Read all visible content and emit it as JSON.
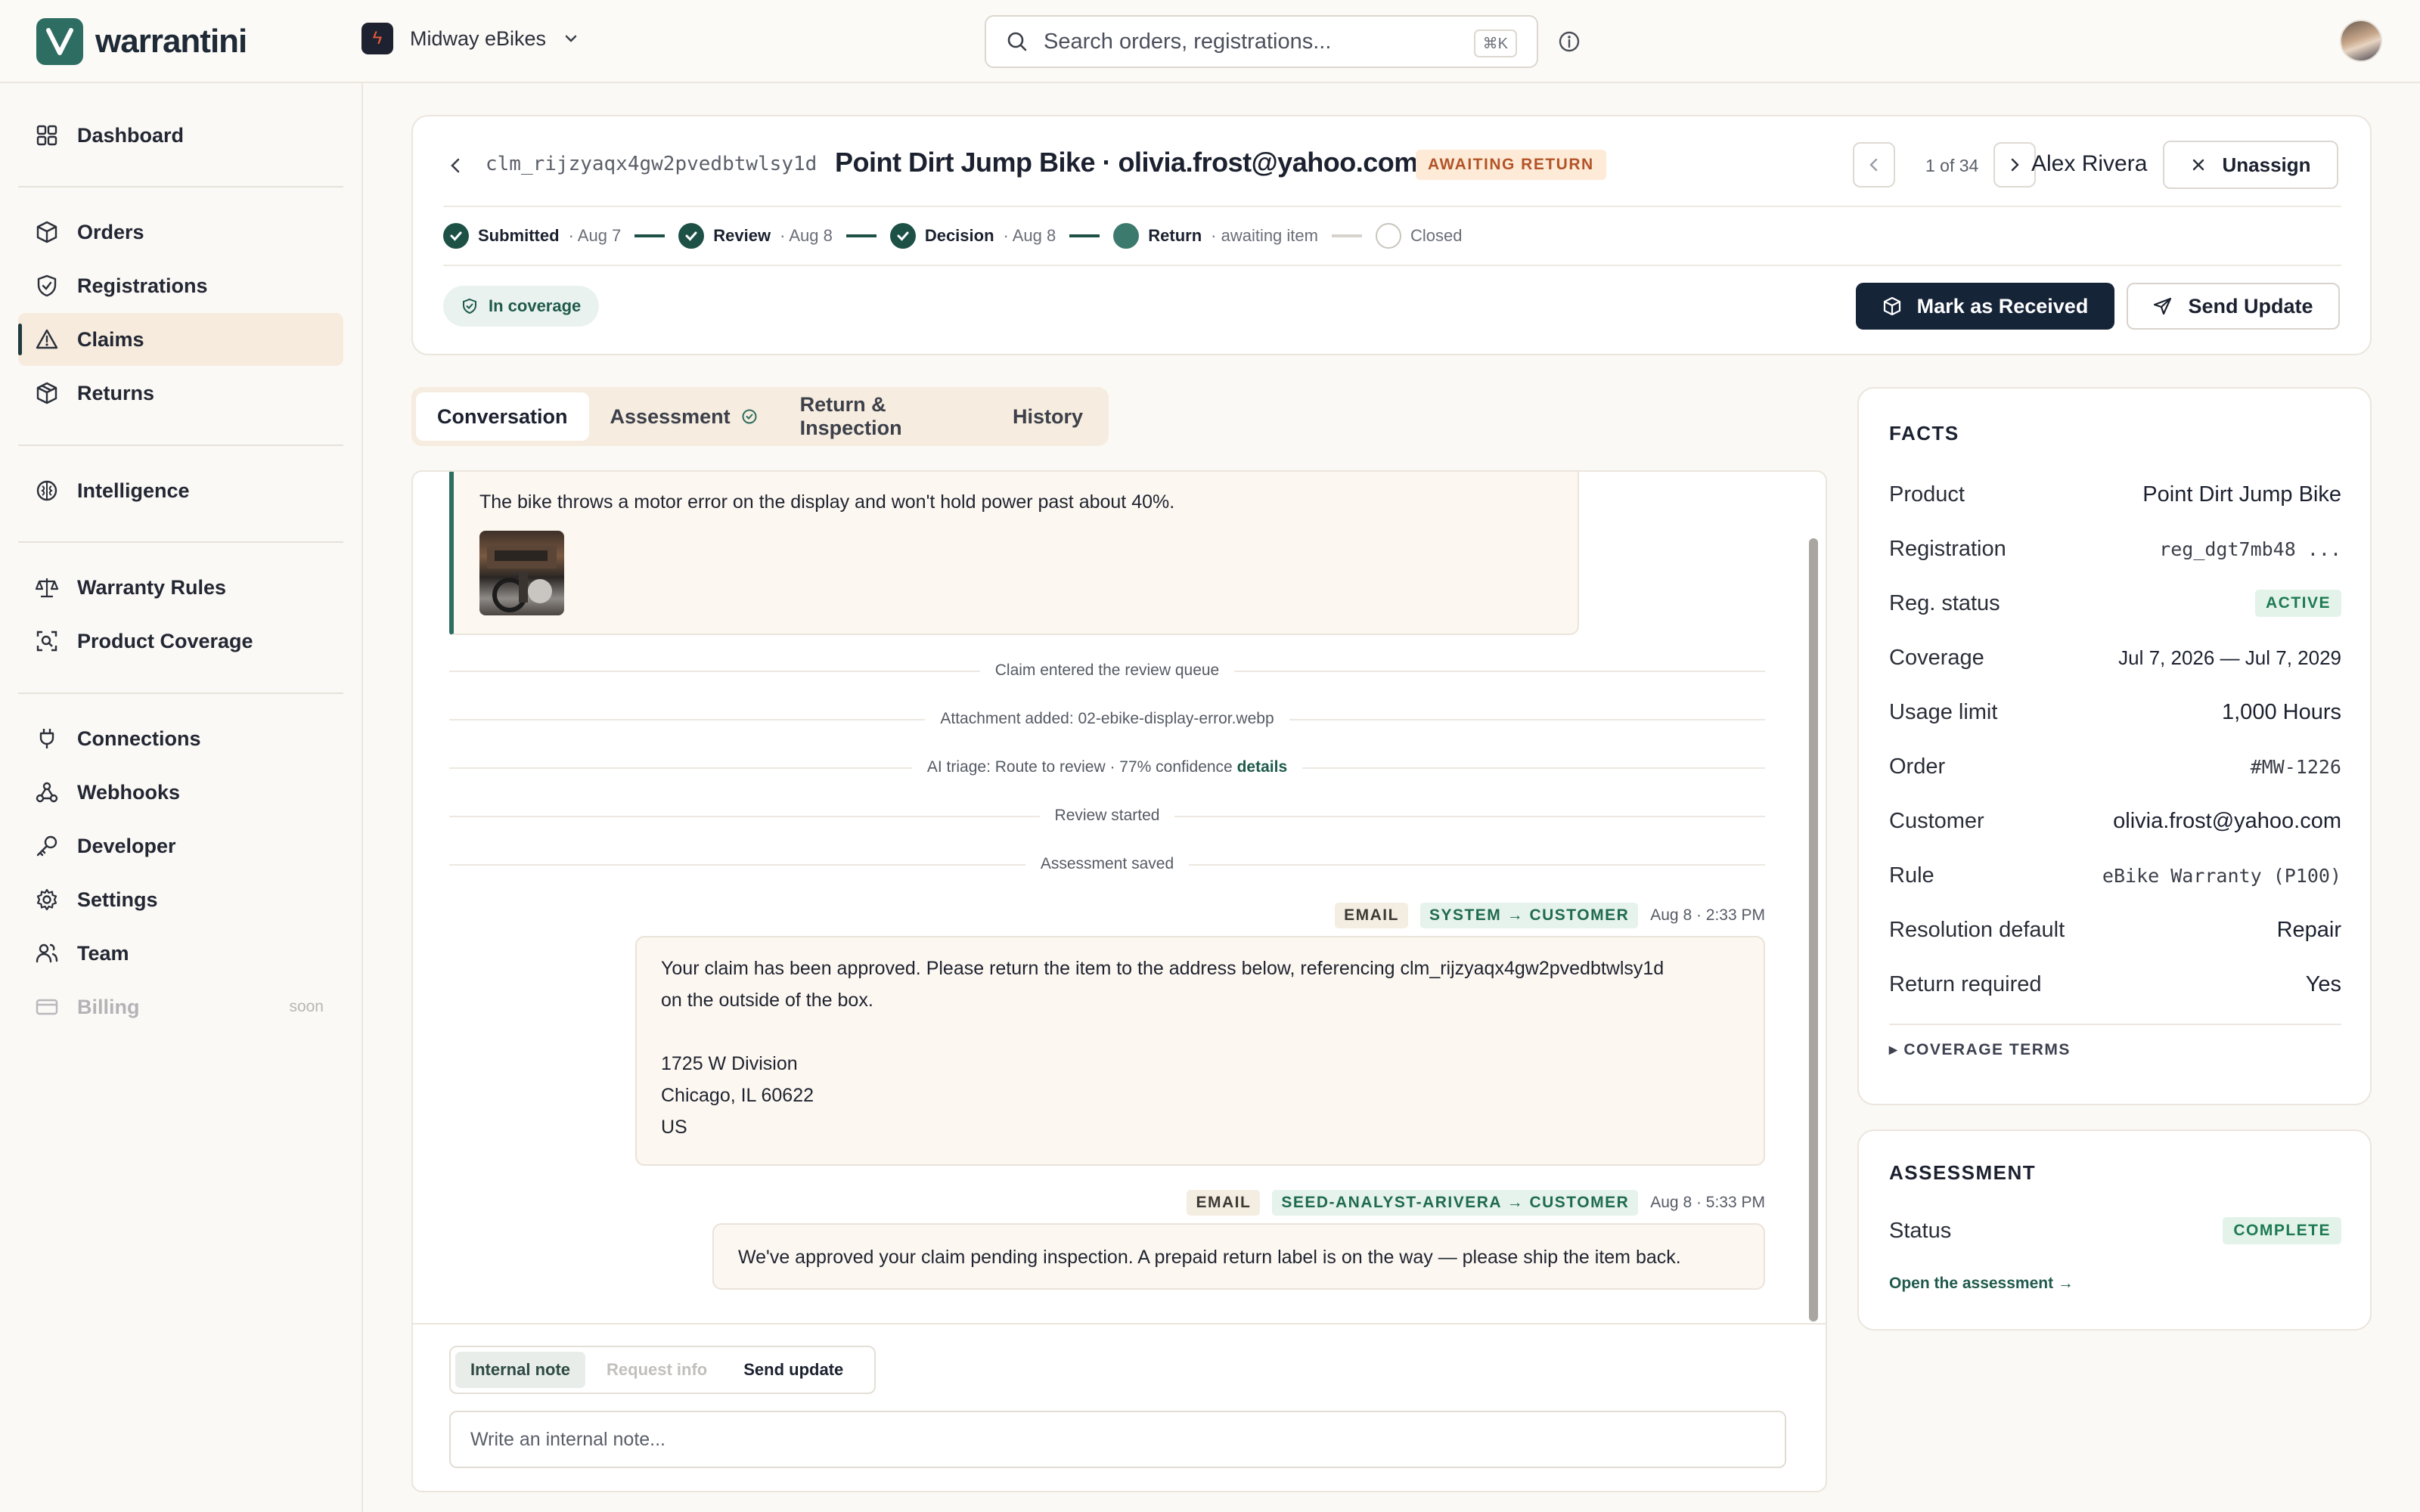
{
  "brand": {
    "name": "warrantini",
    "accent": "#2e6e62"
  },
  "org": {
    "name": "Midway eBikes"
  },
  "search": {
    "placeholder": "Search orders, registrations...",
    "shortcut": "⌘K"
  },
  "sidebar": {
    "items": [
      {
        "label": "Dashboard",
        "icon": "grid-icon"
      },
      {
        "label": "Orders",
        "icon": "box-icon"
      },
      {
        "label": "Registrations",
        "icon": "shield-check-icon"
      },
      {
        "label": "Claims",
        "icon": "warning-triangle-icon",
        "active": true
      },
      {
        "label": "Returns",
        "icon": "return-box-icon"
      },
      {
        "label": "Intelligence",
        "icon": "brain-icon"
      },
      {
        "label": "Warranty Rules",
        "icon": "scales-icon"
      },
      {
        "label": "Product Coverage",
        "icon": "scan-icon"
      },
      {
        "label": "Connections",
        "icon": "plug-icon"
      },
      {
        "label": "Webhooks",
        "icon": "webhook-icon"
      },
      {
        "label": "Developer",
        "icon": "key-icon"
      },
      {
        "label": "Settings",
        "icon": "gear-icon"
      },
      {
        "label": "Team",
        "icon": "users-icon"
      },
      {
        "label": "Billing",
        "icon": "card-icon",
        "badge": "soon",
        "disabled": true
      }
    ]
  },
  "claim": {
    "id": "clm_rijzyaqx4gw2pvedbtwlsy1d",
    "title": "Point Dirt Jump Bike · olivia.frost@yahoo.com",
    "status": "AWAITING RETURN",
    "pagination": "1 of 34",
    "assignee": "Alex Rivera",
    "unassign_label": "Unassign",
    "steps": [
      {
        "label": "Submitted",
        "date": "· Aug 7",
        "state": "done"
      },
      {
        "label": "Review",
        "date": "· Aug 8",
        "state": "done"
      },
      {
        "label": "Decision",
        "date": "· Aug 8",
        "state": "done"
      },
      {
        "label": "Return",
        "date": "· awaiting item",
        "state": "current"
      },
      {
        "label": "Closed",
        "date": "",
        "state": "pending"
      }
    ],
    "coverage_pill": "In coverage",
    "mark_received_label": "Mark as Received",
    "send_update_label": "Send Update"
  },
  "tabs": [
    {
      "label": "Conversation",
      "active": true
    },
    {
      "label": "Assessment"
    },
    {
      "label": "Return & Inspection"
    },
    {
      "label": "History"
    }
  ],
  "conversation": {
    "incoming": {
      "text": "The bike throws a motor error on the display and won't hold power past about 40%."
    },
    "events": [
      {
        "text": "Claim entered the review queue"
      },
      {
        "text": "Attachment added: 02-ebike-display-error.webp"
      },
      {
        "text": "AI triage: Route to review · 77% confidence",
        "link": "details"
      },
      {
        "text": "Review started"
      },
      {
        "text": "Assessment saved"
      }
    ],
    "messages": [
      {
        "channel": "EMAIL",
        "route": "SYSTEM → CUSTOMER",
        "time": "Aug 8 · 2:33 PM",
        "lines": [
          "Your claim has been approved. Please return the item to the address below, referencing clm_rijzyaqx4gw2pvedbtwlsy1d",
          "on the outside of the box.",
          "",
          "1725 W Division",
          "Chicago, IL 60622",
          "US"
        ]
      },
      {
        "channel": "EMAIL",
        "route": "SEED-ANALYST-ARIVERA → CUSTOMER",
        "time": "Aug 8 · 5:33 PM",
        "lines": [
          "We've approved your claim pending inspection. A prepaid return label is on the way — please ship the item back."
        ]
      }
    ],
    "composer": {
      "tabs": [
        {
          "label": "Internal note",
          "active": true
        },
        {
          "label": "Request info",
          "disabled": true
        },
        {
          "label": "Send update"
        }
      ],
      "placeholder": "Write an internal note..."
    }
  },
  "facts": {
    "title": "FACTS",
    "rows": [
      {
        "key": "Product",
        "value": "Point Dirt Jump Bike"
      },
      {
        "key": "Registration",
        "value": "reg_dgt7mb48 ...",
        "mono": true
      },
      {
        "key": "Reg. status",
        "value": "ACTIVE",
        "pill": true
      },
      {
        "key": "Coverage",
        "value": "Jul 7, 2026 — Jul 7, 2029"
      },
      {
        "key": "Usage limit",
        "value": "1,000 Hours"
      },
      {
        "key": "Order",
        "value": "#MW-1226",
        "mono": true
      },
      {
        "key": "Customer",
        "value": "olivia.frost@yahoo.com"
      },
      {
        "key": "Rule",
        "value": "eBike Warranty (P100)",
        "mono": true
      },
      {
        "key": "Resolution default",
        "value": "Repair"
      },
      {
        "key": "Return required",
        "value": "Yes"
      }
    ],
    "coverage_terms_label": "▸ COVERAGE TERMS"
  },
  "assessment": {
    "title": "ASSESSMENT",
    "status_key": "Status",
    "status_value": "COMPLETE",
    "link": "Open the assessment →"
  }
}
